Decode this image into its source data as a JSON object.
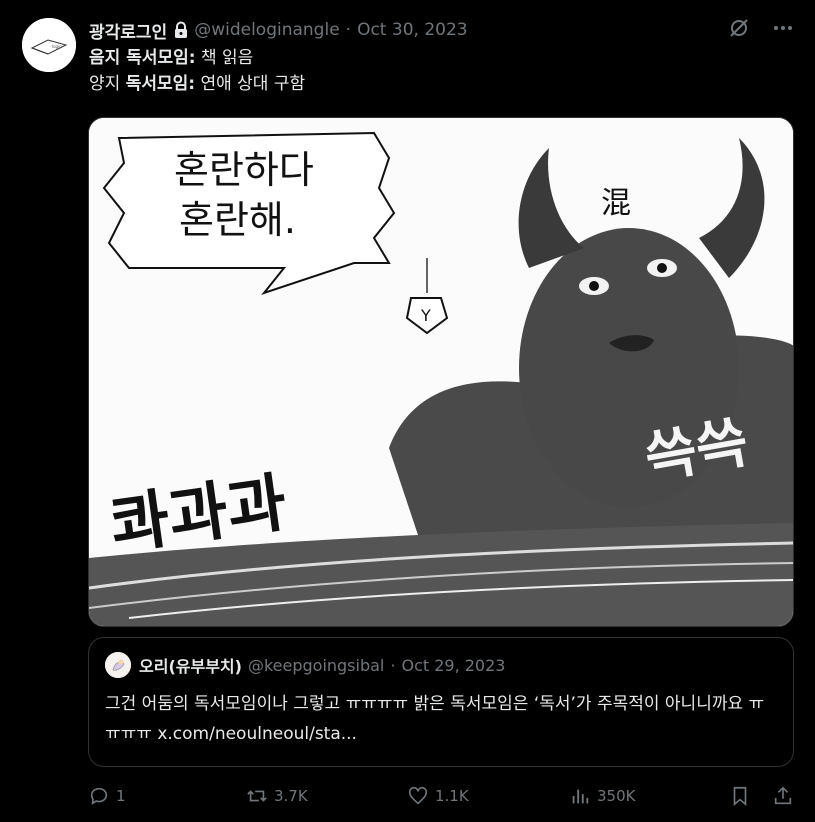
{
  "tweet": {
    "author_name": "광각로그인",
    "handle": "@wideloginangle",
    "separator": "·",
    "date": "Oct 30, 2023",
    "lines": [
      {
        "label": "음지 독서모임:",
        "value": " 책 읽음",
        "prefix": ""
      },
      {
        "prefix": "양지 ",
        "label": "독서모임:",
        "value": " 연애 상대 구함"
      }
    ]
  },
  "media": {
    "speech_line1": "혼란하다",
    "speech_line2": "혼란해.",
    "sfx_left": "콰과과",
    "sfx_right": "쓱쓱",
    "forehead_char": "混",
    "tag_char": "Y"
  },
  "quote": {
    "author_name": "오리(유부부치)",
    "handle": "@keepgoingsibal",
    "separator": "·",
    "date": "Oct 29, 2023",
    "text": "그건 어둠의 독서모임이나 그렇고 ㅠㅠㅠㅠ 밝은 독서모임은 ‘독서’가 주목적이 아니니까요 ㅠㅠㅠㅠ x.com/neoulneoul/sta..."
  },
  "actions": {
    "replies": "1",
    "retweets": "3.7K",
    "likes": "1.1K",
    "views": "350K"
  }
}
